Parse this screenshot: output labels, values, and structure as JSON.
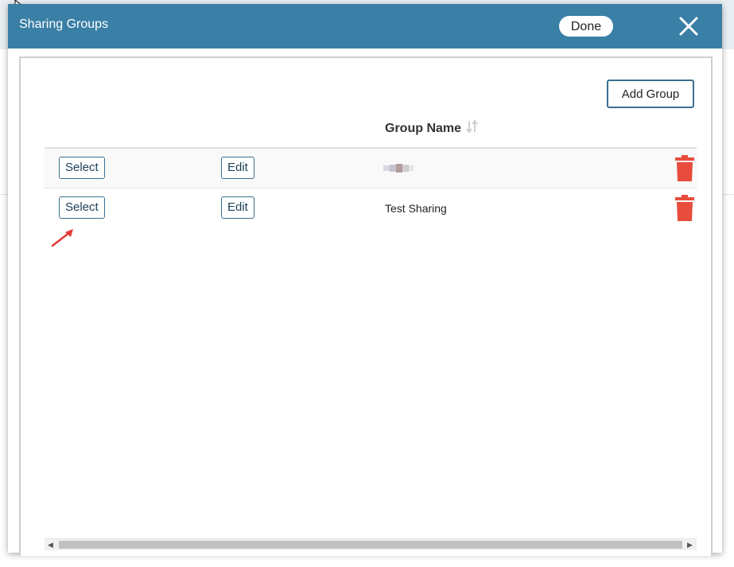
{
  "modal": {
    "title": "Sharing Groups",
    "done_label": "Done",
    "add_group_label": "Add Group",
    "table": {
      "column_group_name": "Group Name",
      "rows": [
        {
          "select_label": "Select",
          "edit_label": "Edit",
          "group_name": ""
        },
        {
          "select_label": "Select",
          "edit_label": "Edit",
          "group_name": "Test Sharing"
        }
      ]
    }
  },
  "colors": {
    "header": "#3a7fa6",
    "delete": "#e74c3c",
    "annotation_arrow": "#e53935"
  },
  "icons": [
    "close-icon",
    "sort-icon",
    "trash-icon",
    "mouse-cursor-icon",
    "annotation-arrow"
  ]
}
